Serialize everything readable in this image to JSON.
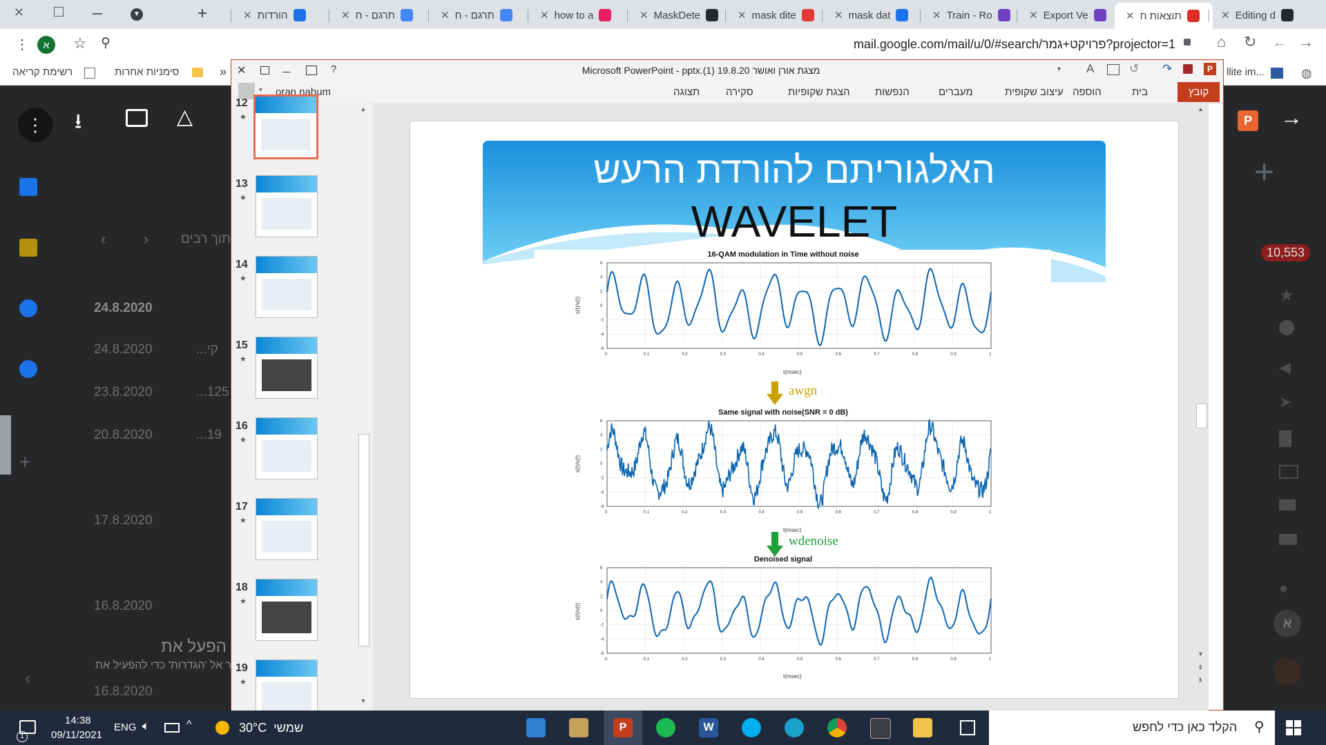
{
  "browser": {
    "tabs": [
      {
        "label": "Editing d",
        "x": 1762
      },
      {
        "label": "תוצאות ח",
        "x": 1624,
        "active": true
      },
      {
        "label": "Export Ve",
        "x": 1484
      },
      {
        "label": "Train - Ro",
        "x": 1344
      },
      {
        "label": "mask dat",
        "x": 1202
      },
      {
        "label": "mask dite",
        "x": 1062
      },
      {
        "label": "MaskDete",
        "x": 920
      },
      {
        "label": "how to a",
        "x": 776
      },
      {
        "label": "תרגם - ח",
        "x": 632
      },
      {
        "label": "תרגם - ח",
        "x": 488
      },
      {
        "label": "הורדות",
        "x": 346
      }
    ],
    "url": "mail.google.com/mail/u/0/#search/פרויקט+גמר?projector=1",
    "profile_initial": "א",
    "bookmarks": {
      "reading_list": "רשימת קריאה",
      "other_bookmarks": "סימניות אחרות",
      "overflow": "»",
      "right_item": "llite im..."
    }
  },
  "gmail": {
    "search_hint": "תוך רבים",
    "dates": [
      "24.8.2020",
      "24.8.2020",
      "23.8.2020",
      "20.8.2020",
      "17.8.2020",
      "16.8.2020",
      "16.8.2020"
    ],
    "snippets": [
      "...קי",
      "...125",
      "...19"
    ],
    "unread_count": "10,553",
    "avatar_initial": "א"
  },
  "activation": {
    "title": "הפעל את Windows",
    "subtitle": "עבור אל 'הגדרות' כדי להפעיל את Windows."
  },
  "ppt": {
    "title": "Microsoft PowerPoint - pptx.(1) 19.8.20 מצגת אורן ואושר",
    "user": "oran nahum",
    "ribbon_tabs": [
      "קובץ",
      "בית",
      "הוספה",
      "עיצוב שקופית",
      "מעברים",
      "הנפשות",
      "הצגת שקופיות",
      "סקירה",
      "תצוגה"
    ],
    "thumbnails": [
      {
        "num": "12"
      },
      {
        "num": "13"
      },
      {
        "num": "14"
      },
      {
        "num": "15"
      },
      {
        "num": "16"
      },
      {
        "num": "17"
      },
      {
        "num": "18"
      },
      {
        "num": "19"
      }
    ],
    "slide": {
      "title_line1": "האלגוריתם להורדת הרעש",
      "title_line2": "WAVELET",
      "arrow1_label": "awgn",
      "arrow2_label": "wdenoise",
      "arrow1_color": "#c9a000",
      "arrow2_color": "#1f9e3a",
      "charts": [
        {
          "title": "16-QAM modulation in Time without noise",
          "xlabel": "t(msec)",
          "ylabel": "s(t)/v(t)"
        },
        {
          "title": "Same signal with noise(SNR = 0 dB)",
          "xlabel": "t(msec)",
          "ylabel": "s(t)/v(t)"
        },
        {
          "title": "Denoised signal",
          "xlabel": "t(msec)",
          "ylabel": "s(t)/v(t)"
        }
      ],
      "xticks": [
        "0",
        "0.1",
        "0.2",
        "0.3",
        "0.4",
        "0.5",
        "0.6",
        "0.7",
        "0.8",
        "0.9",
        "1"
      ],
      "yticks": [
        "6",
        "4",
        "2",
        "0",
        "-2",
        "-4",
        "-6"
      ]
    }
  },
  "taskbar": {
    "search_placeholder": "הקלד כאן כדי לחפש",
    "weather_temp": "30°C",
    "weather_desc": "שמשי",
    "lang": "ENG",
    "time": "14:38",
    "date": "09/11/2021",
    "notif_count": "1"
  }
}
